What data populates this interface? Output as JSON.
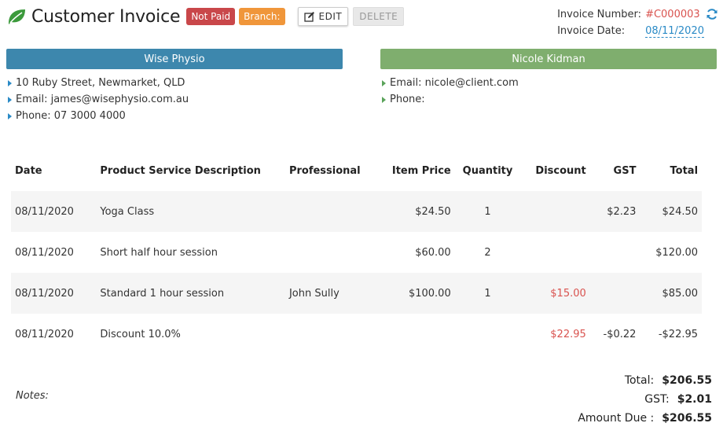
{
  "header": {
    "title": "Customer Invoice",
    "status_badge": "Not Paid",
    "branch_badge": "Branch:",
    "edit_label": "EDIT",
    "delete_label": "DELETE"
  },
  "invoice": {
    "number_label": "Invoice Number:",
    "number": "#C000003",
    "date_label": "Invoice Date:",
    "date": "08/11/2020"
  },
  "business": {
    "name": "Wise Physio",
    "address": "10 Ruby Street, Newmarket, QLD",
    "email": "Email: james@wisephysio.com.au",
    "phone": "Phone: 07 3000 4000"
  },
  "client": {
    "name": "Nicole Kidman",
    "email": "Email: nicole@client.com",
    "phone": "Phone:"
  },
  "table": {
    "headers": {
      "date": "Date",
      "desc": "Product Service Description",
      "prof": "Professional",
      "price": "Item Price",
      "qty": "Quantity",
      "disc": "Discount",
      "gst": "GST",
      "total": "Total"
    },
    "rows": [
      {
        "date": "08/11/2020",
        "desc": "Yoga Class",
        "prof": "",
        "price": "$24.50",
        "qty": "1",
        "disc": "",
        "gst": "$2.23",
        "total": "$24.50"
      },
      {
        "date": "08/11/2020",
        "desc": "Short half hour session",
        "prof": "",
        "price": "$60.00",
        "qty": "2",
        "disc": "",
        "gst": "",
        "total": "$120.00"
      },
      {
        "date": "08/11/2020",
        "desc": "Standard 1 hour session",
        "prof": "John Sully",
        "price": "$100.00",
        "qty": "1",
        "disc": "$15.00",
        "gst": "",
        "total": "$85.00"
      },
      {
        "date": "08/11/2020",
        "desc": "Discount 10.0%",
        "prof": "",
        "price": "",
        "qty": "",
        "disc": "$22.95",
        "gst": "-$0.22",
        "total": "-$22.95"
      }
    ]
  },
  "notes_label": "Notes:",
  "totals": {
    "total_label": "Total:",
    "total": "$206.55",
    "gst_label": "GST:",
    "gst": "$2.01",
    "due_label": "Amount Due :",
    "due": "$206.55"
  },
  "colors": {
    "business_bar": "#3d87ad",
    "client_bar": "#7fae6e",
    "not_paid": "#c9474a",
    "branch": "#f0963a",
    "accent_red": "#d9534f",
    "link_blue": "#2a8ac6"
  },
  "icons": {
    "logo": "leaf-icon",
    "edit": "pencil-square-icon",
    "refresh": "refresh-icon"
  }
}
